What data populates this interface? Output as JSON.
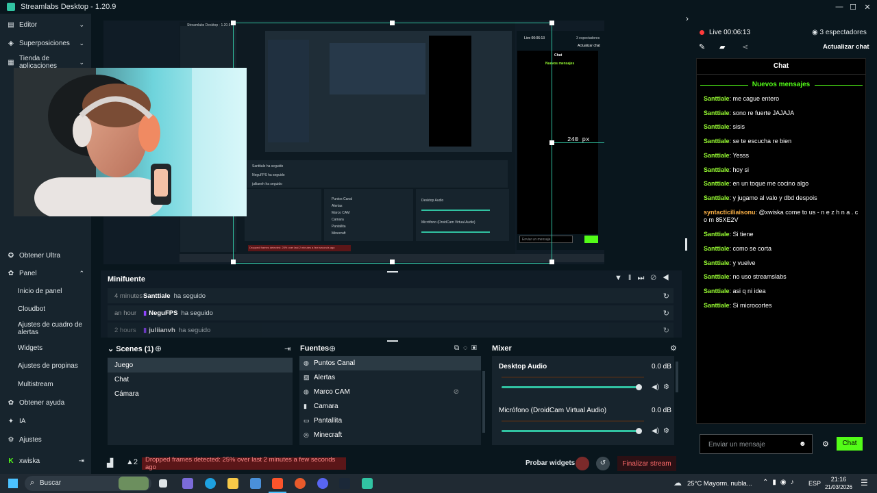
{
  "app": {
    "title": "Streamlabs Desktop - 1.20.9"
  },
  "sidebar": {
    "items": [
      {
        "label": "Editor",
        "icon": "editor-icon"
      },
      {
        "label": "Superposiciones",
        "icon": "overlays-icon"
      },
      {
        "label": "Tienda de aplicaciones",
        "icon": "store-icon"
      }
    ],
    "obtain_ultra": "Obtener Ultra",
    "panel": "Panel",
    "panel_items": [
      "Inicio de panel",
      "Cloudbot",
      "Ajustes de cuadro de alertas",
      "Widgets",
      "Ajustes de propinas",
      "Multistream"
    ],
    "help": "Obtener ayuda",
    "ai": "IA",
    "settings": "Ajustes",
    "user": "xwiska"
  },
  "preview": {
    "inner_title": "Streamlabs Desktop - 1.20.9",
    "size_label": "240 px",
    "inner_live": "Live 00:06:13",
    "inner_viewers": "3 espectadores",
    "inner_refresh": "Actualizar chat",
    "inner_chat": "Chat",
    "inner_new": "Nuevos mensajes",
    "inner_send": "Enviar un mensaje",
    "inner_warning": "Dropped frames detected: 25% over last 2 minutes a few seconds ago"
  },
  "minifeed": {
    "title": "Minifuente",
    "rows": [
      {
        "time": "4 minutes",
        "name": "Santtiale",
        "action": "ha seguido"
      },
      {
        "time": "an hour",
        "name": "NeguFPS",
        "action": "ha seguido"
      },
      {
        "time": "2 hours",
        "name": "juliianvh",
        "action": "ha seguido"
      }
    ]
  },
  "scenes": {
    "title": "Scenes (1)",
    "items": [
      "Juego",
      "Chat",
      "Cámara"
    ]
  },
  "sources": {
    "title": "Fuentes",
    "items": [
      {
        "label": "Puntos Canal",
        "icon": "globe-icon"
      },
      {
        "label": "Alertas",
        "icon": "image-icon"
      },
      {
        "label": "Marco CAM",
        "icon": "globe-icon"
      },
      {
        "label": "Camara",
        "icon": "camera-icon"
      },
      {
        "label": "Pantallita",
        "icon": "monitor-icon"
      },
      {
        "label": "Minecraft",
        "icon": "gamepad-icon"
      }
    ]
  },
  "mixer": {
    "title": "Mixer",
    "channels": [
      {
        "name": "Desktop Audio",
        "db": "0.0 dB",
        "level": 1.0
      },
      {
        "name": "Micrófono (DroidCam Virtual Audio)",
        "db": "0.0 dB",
        "level": 1.0
      }
    ]
  },
  "footer": {
    "alerts_count": "2",
    "warning": "Dropped frames detected: 25% over last 2 minutes a few seconds ago",
    "test_widgets": "Probar widgets",
    "end_stream": "Finalizar stream"
  },
  "chat": {
    "live": "Live 00:06:13",
    "viewers": "3 espectadores",
    "refresh": "Actualizar chat",
    "title": "Chat",
    "new_messages": "Nuevos mensajes",
    "messages": [
      {
        "user": "Santtiale",
        "text": "me cague entero"
      },
      {
        "user": "Santtiale",
        "text": "sono re fuerte JAJAJA"
      },
      {
        "user": "Santtiale",
        "text": "sisis"
      },
      {
        "user": "Santtiale",
        "text": "se te escucha re bien"
      },
      {
        "user": "Santtiale",
        "text": "Yesss"
      },
      {
        "user": "Santtiale",
        "text": "hoy si"
      },
      {
        "user": "Santtiale",
        "text": "en un toque me cocino algo"
      },
      {
        "user": "Santtiale",
        "text": "y jugamo al valo y dbd despois"
      },
      {
        "user": "syntacticiliaisonu",
        "text": "@xwiska come to us - n e z h n a . c o m 85XE2V"
      },
      {
        "user": "Santtiale",
        "text": "Si tiene"
      },
      {
        "user": "Santtiale",
        "text": "como se corta"
      },
      {
        "user": "Santtiale",
        "text": "y vuelve"
      },
      {
        "user": "Santtiale",
        "text": "no uso streamslabs"
      },
      {
        "user": "Santtiale",
        "text": "asi q ni idea"
      },
      {
        "user": "Santtiale",
        "text": "Si microcortes"
      }
    ],
    "input_placeholder": "Enviar un mensaje",
    "send": "Chat"
  },
  "taskbar": {
    "search": "Buscar",
    "weather": "25°C  Mayorm. nubla...",
    "lang": "ESP",
    "time": "21:16",
    "date": "21/03/2026"
  },
  "colors": {
    "accent": "#31c3a2",
    "chat_user": "#99ff33",
    "warning_bg": "#5b1618"
  }
}
